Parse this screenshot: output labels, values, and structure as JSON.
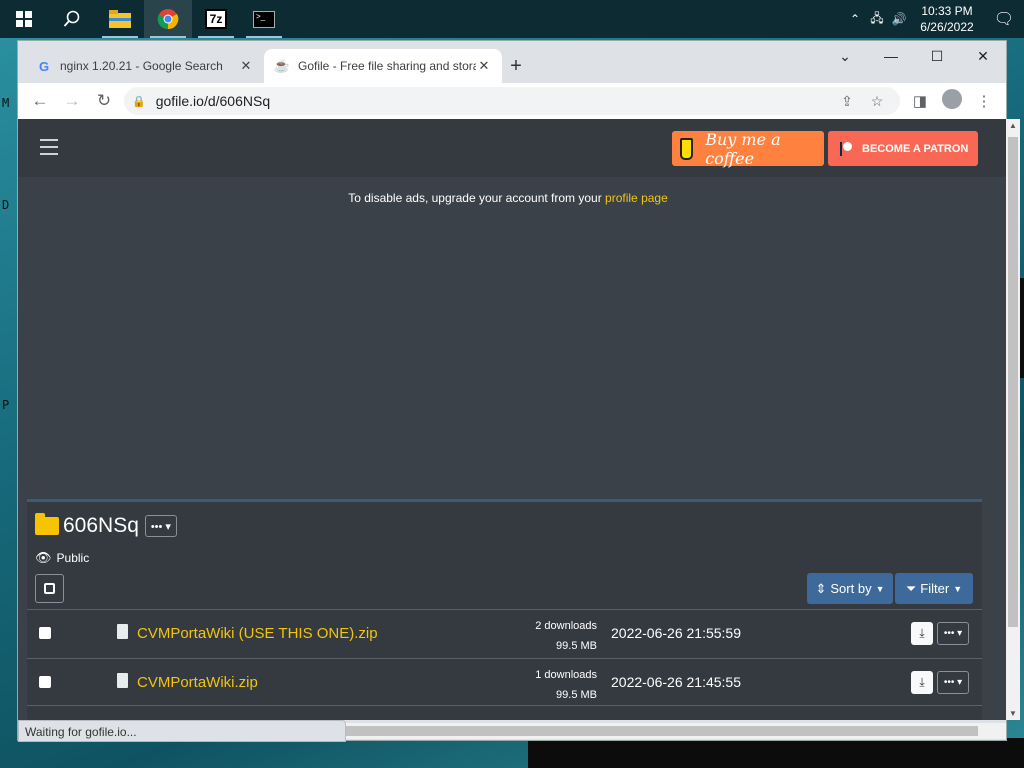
{
  "taskbar": {
    "time": "10:33 PM",
    "date": "6/26/2022",
    "icons": [
      "windows-start",
      "search",
      "file-explorer",
      "chrome",
      "7zip",
      "terminal"
    ]
  },
  "browser": {
    "tabs": [
      {
        "title": "nginx 1.20.21 - Google Search",
        "favicon": "G"
      },
      {
        "title": "Gofile - Free file sharing and storage",
        "favicon": "☕"
      }
    ],
    "url": "gofile.io/d/606NSq",
    "status": "Waiting for gofile.io..."
  },
  "page": {
    "coffee_label": "Buy me a coffee",
    "patron_label": "BECOME A PATRON",
    "ad_text": "To disable ads, upgrade your account from your ",
    "ad_link": "profile page",
    "folder": {
      "name": "606NSq",
      "visibility": "Public",
      "sort_label": "Sort by",
      "filter_label": "Filter"
    },
    "files": [
      {
        "name": "CVMPortaWiki (USE THIS ONE).zip",
        "downloads": "2 downloads",
        "size": "99.5 MB",
        "date": "2022-06-26 21:55:59"
      },
      {
        "name": "CVMPortaWiki.zip",
        "downloads": "1 downloads",
        "size": "99.5 MB",
        "date": "2022-06-26 21:45:55"
      }
    ]
  }
}
